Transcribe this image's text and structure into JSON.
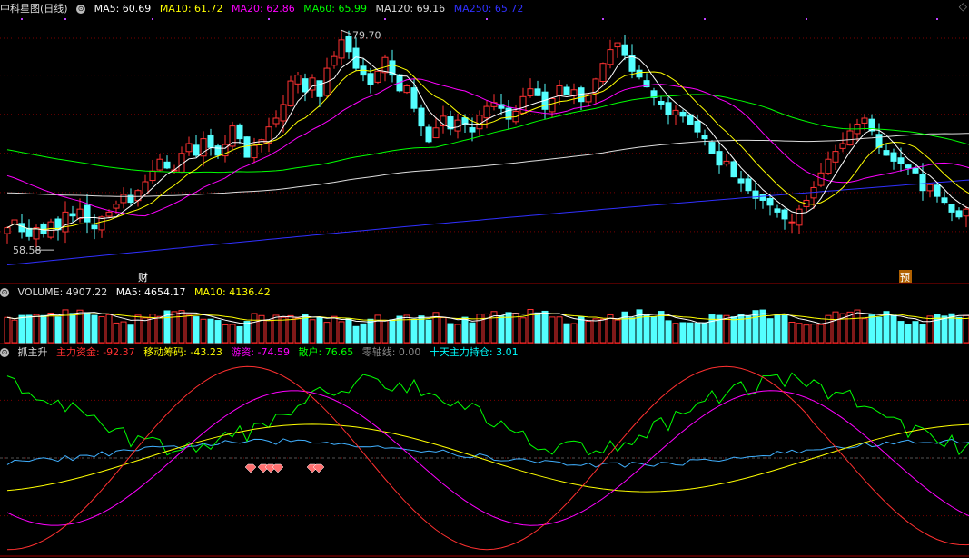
{
  "main": {
    "title": "中科星图(日线)",
    "indicators": [
      {
        "label": "MA5: 60.69",
        "color": "#ffffff"
      },
      {
        "label": "MA10: 61.72",
        "color": "#ffff00"
      },
      {
        "label": "MA20: 62.86",
        "color": "#ff00ff"
      },
      {
        "label": "MA60: 65.99",
        "color": "#00ff00"
      },
      {
        "label": "MA120: 69.16",
        "color": "#dddddd"
      },
      {
        "label": "MA250: 65.72",
        "color": "#3030ff"
      }
    ],
    "high_label": "79.70",
    "low_label": "58.58",
    "event_label_1": "财",
    "event_label_2": "预",
    "ylim": [
      56,
      82
    ]
  },
  "volume": {
    "title": "VOLUME: 4907.22",
    "indicators": [
      {
        "label": "MA5: 4654.17",
        "color": "#ffffff"
      },
      {
        "label": "MA10: 4136.42",
        "color": "#ffff00"
      }
    ],
    "ylim": [
      0,
      7000
    ]
  },
  "indicator": {
    "title": "抓主升",
    "indicators": [
      {
        "label": "主力资金: -92.37",
        "color": "#ff3030"
      },
      {
        "label": "移动筹码: -43.23",
        "color": "#ffff00"
      },
      {
        "label": "游资: -74.59",
        "color": "#ff00ff"
      },
      {
        "label": "散户: 76.65",
        "color": "#00ff00"
      },
      {
        "label": "零轴线: 0.00",
        "color": "#888888"
      },
      {
        "label": "十天主力持仓: 3.01",
        "color": "#00ffff"
      }
    ],
    "ylim": [
      -100,
      100
    ]
  },
  "colors": {
    "up": "#ff3232",
    "down": "#54ffff",
    "grid": "#7a0000",
    "separator": "#a00000",
    "ma5": "#ffffff",
    "ma10": "#ffff00",
    "ma20": "#ff00ff",
    "ma60": "#00ff00",
    "ma120": "#dddddd",
    "ma250": "#3030ff"
  },
  "chart_data": {
    "type": "candlestick",
    "x_count": 133,
    "ohlc_close": [
      60.4,
      61.2,
      60.0,
      59.5,
      60.4,
      59.8,
      61.0,
      60.2,
      62.0,
      61.6,
      62.3,
      61.0,
      60.3,
      61.5,
      62.0,
      62.8,
      63.8,
      63.0,
      64.2,
      65.1,
      66.2,
      67.4,
      66.5,
      66.3,
      68.0,
      69.0,
      67.8,
      69.5,
      68.6,
      67.8,
      68.9,
      70.8,
      69.5,
      67.6,
      68.8,
      69.4,
      70.7,
      71.6,
      73.0,
      75.4,
      76.0,
      74.3,
      75.7,
      73.8,
      76.7,
      77.9,
      79.6,
      78.4,
      76.7,
      76.0,
      75.0,
      76.4,
      77.8,
      76.0,
      74.4,
      74.9,
      72.6,
      70.8,
      69.2,
      70.6,
      71.8,
      70.5,
      71.4,
      71.0,
      70.2,
      71.9,
      72.8,
      73.2,
      72.6,
      71.5,
      72.3,
      73.8,
      74.6,
      73.9,
      72.5,
      73.6,
      74.9,
      74.0,
      74.5,
      73.3,
      74.0,
      75.6,
      77.2,
      78.6,
      79.3,
      78.0,
      76.4,
      75.8,
      74.8,
      73.7,
      73.0,
      72.0,
      72.4,
      71.8,
      71.0,
      70.2,
      69.5,
      68.0,
      66.8,
      67.2,
      65.6,
      65.0,
      64.2,
      63.4,
      63.2,
      62.7,
      62.0,
      61.3,
      61.0,
      62.3,
      63.2,
      64.5,
      66.0,
      67.4,
      68.2,
      69.0,
      70.3,
      71.0,
      71.6,
      70.3,
      68.6,
      67.8,
      67.2,
      67.0,
      66.5,
      66.0,
      64.2,
      64.8,
      63.6,
      63.0,
      62.0,
      61.5,
      62.3,
      62.5,
      61.8,
      61.0,
      58.9,
      60.0,
      60.7
    ],
    "series": [
      {
        "name": "MA5",
        "values": [
          60.69
        ]
      },
      {
        "name": "MA10",
        "values": [
          61.72
        ]
      },
      {
        "name": "MA20",
        "values": [
          62.86
        ]
      },
      {
        "name": "MA60",
        "values": [
          65.99
        ]
      },
      {
        "name": "MA120",
        "values": [
          69.16
        ]
      },
      {
        "name": "MA250",
        "values": [
          65.72
        ]
      }
    ],
    "ylim": [
      56,
      82
    ]
  }
}
